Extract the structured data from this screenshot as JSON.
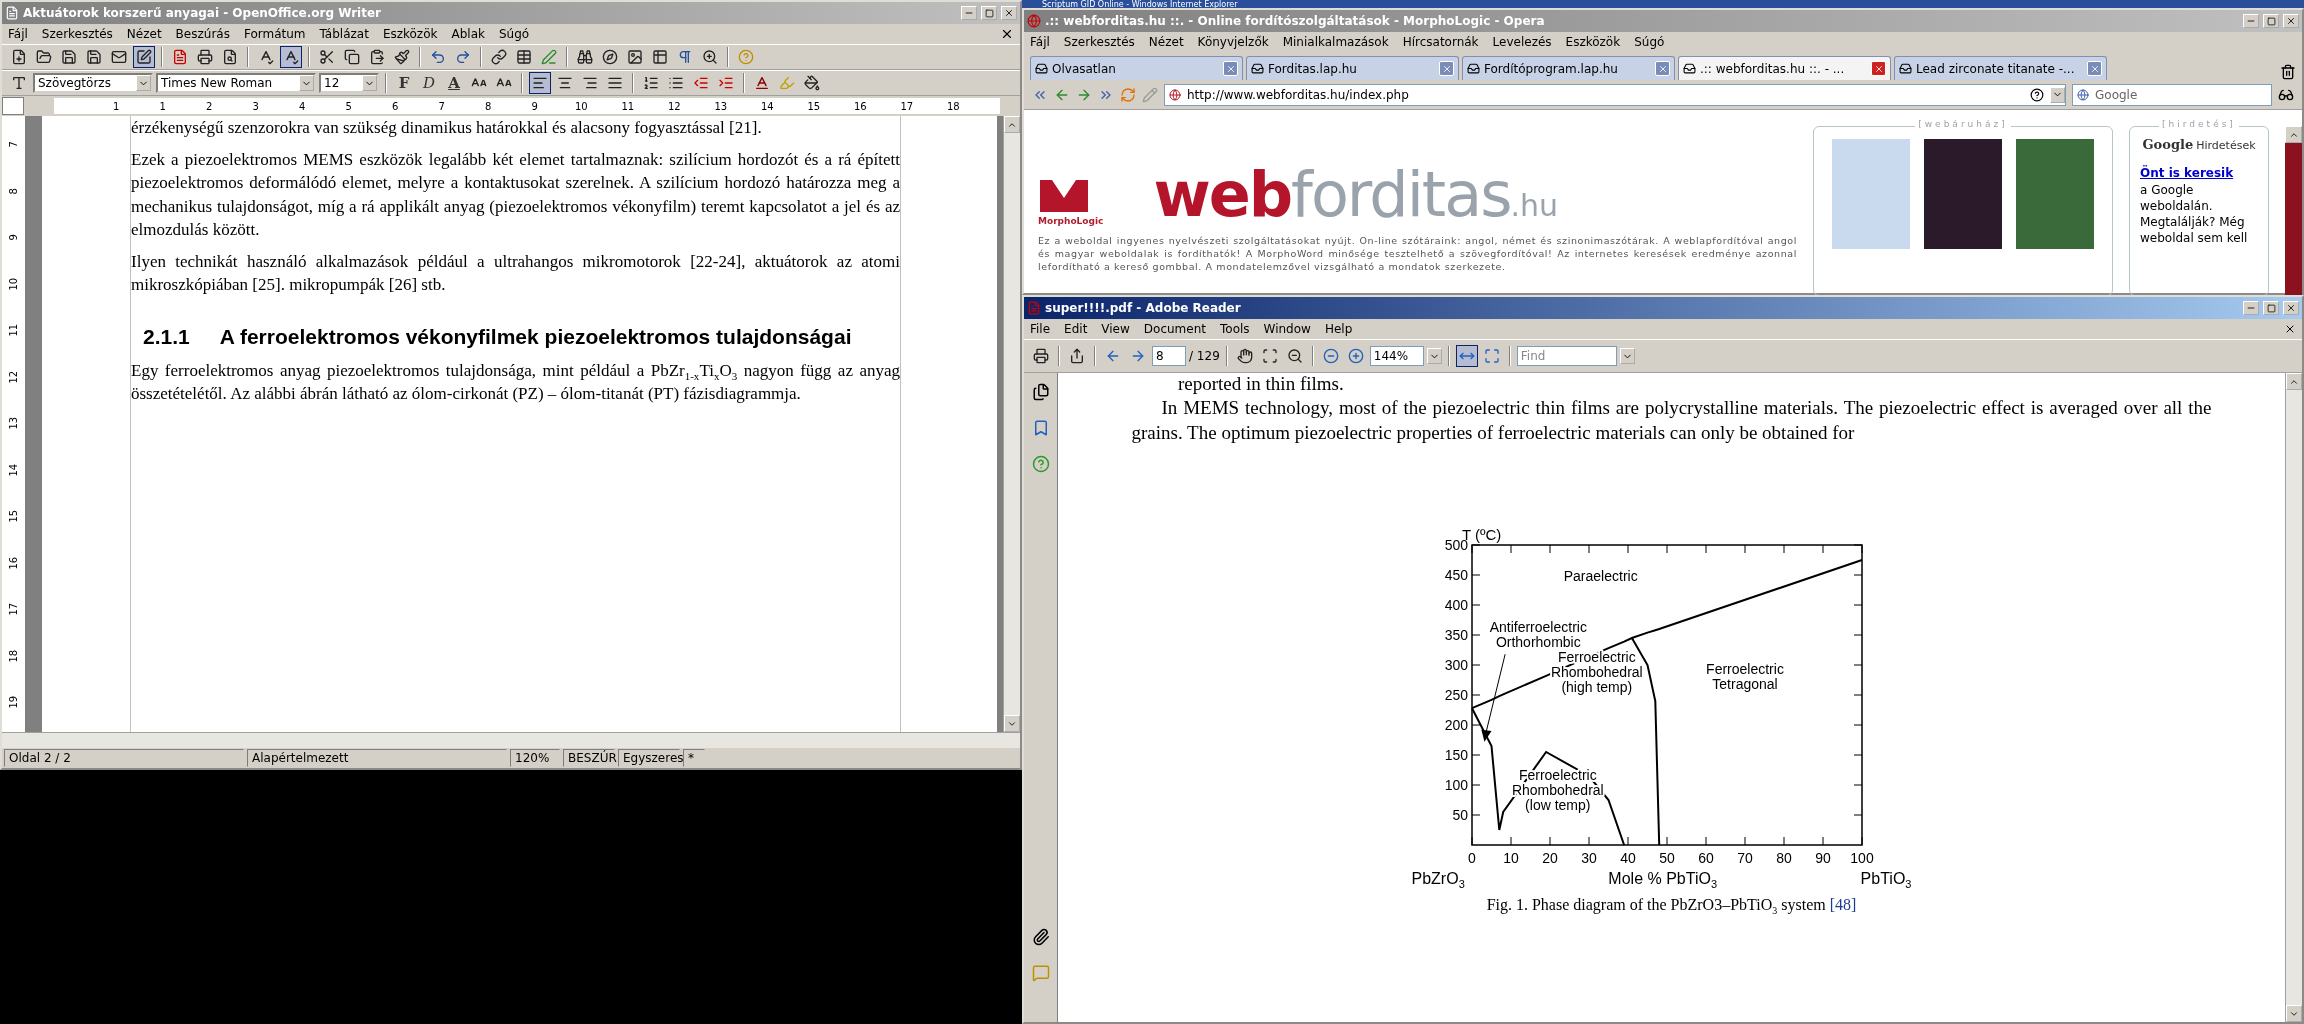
{
  "writer": {
    "title": "Aktuátorok korszerű anyagai - OpenOffice.org Writer",
    "menu": [
      "Fájl",
      "Szerkesztés",
      "Nézet",
      "Beszúrás",
      "Formátum",
      "Táblázat",
      "Eszközök",
      "Ablak",
      "Súgó"
    ],
    "toggles": [
      {
        "kind": "edit-mode",
        "on": true
      },
      {
        "kind": "auto-spellcheck",
        "on": true
      }
    ],
    "paragraph_style": "Szövegtörzs",
    "font_name": "Times New Roman",
    "font_size": "12",
    "format_buttons": [
      "F",
      "D",
      "A"
    ],
    "alignment": [
      {
        "kind": "left",
        "selected": true
      },
      {
        "kind": "center",
        "selected": false
      },
      {
        "kind": "right",
        "selected": false
      },
      {
        "kind": "justify",
        "selected": false
      }
    ],
    "ruler": {
      "horizontal": [
        "1",
        "1",
        "2",
        "3",
        "4",
        "5",
        "6",
        "7",
        "8",
        "9",
        "10",
        "11",
        "12",
        "13",
        "14",
        "15",
        "16",
        "17",
        "18"
      ],
      "vertical": [
        "7",
        "8",
        "9",
        "10",
        "11",
        "12",
        "13",
        "14",
        "15",
        "16",
        "17",
        "18",
        "19"
      ]
    },
    "document": [
      {
        "kind": "paragraph",
        "text": "érzékenységű szenzorokra van szükség dinamikus határokkal és alacsony fogyasztással [21]."
      },
      {
        "kind": "paragraph",
        "text": "Ezek a piezoelektromos MEMS eszközök legalább két elemet tartalmaznak: szilícium hordozót és a rá épített piezoelektromos deformálódó elemet, melyre a kontaktusokat szerelnek. A szilícium hordozó határozza meg a mechanikus tulajdonságot, míg a rá applikált anyag (piezoelektromos vékonyfilm) teremt kapcsolatot a jel és az elmozdulás között."
      },
      {
        "kind": "paragraph",
        "text": "Ilyen technikát használó alkalmazások például a ultrahangos mikromotorok [22-24], aktuátorok az atomi mikroszkópiában [25]. mikropumpák [26] stb."
      },
      {
        "kind": "heading",
        "number": "2.1.1",
        "text": "A ferroelektromos vékonyfilmek piezoelektromos tulajdonságai"
      },
      {
        "kind": "paragraph",
        "text": "Egy ferroelektromos anyag piezoelektromos tulajdonsága, mint például a PbZr$_{1-x}$Ti$_{x}$O$_{3}$ nagyon függ az anyag összetételétől. Az alábbi ábrán látható az ólom-cirkonát (PZ) – ólom-titanát (PT) fázisdiagrammja."
      }
    ],
    "status_bar": [
      "Oldal 2 / 2",
      "Alapértelmezett",
      "120%",
      "BESZÚR",
      "Egyszeres",
      "*"
    ]
  },
  "ie": {
    "title": "Scriptum GID Online - Windows Internet Explorer"
  },
  "opera": {
    "title": ".:: webforditas.hu ::. - Online fordítószolgáltatások - MorphoLogic - Opera",
    "menu": [
      "Fájl",
      "Szerkesztés",
      "Nézet",
      "Könyvjelzők",
      "Minialkalmazások",
      "Hírcsatornák",
      "Levelezés",
      "Eszközök",
      "Súgó"
    ],
    "tabs": [
      {
        "label": "Olvasatlan",
        "selected": false
      },
      {
        "label": "Forditas.lap.hu",
        "selected": false
      },
      {
        "label": "Fordítóprogram.lap.hu",
        "selected": false
      },
      {
        "label": ".:: webforditas.hu ::. - ...",
        "selected": true
      },
      {
        "label": "Lead zirconate titanate -...",
        "selected": false
      }
    ],
    "address": "http://www.webforditas.hu/index.php",
    "search": "Google",
    "page": {
      "logo_caption": "MorphoLogic",
      "brand": [
        "web",
        "forditas",
        ".hu"
      ],
      "intro": "Ez a weboldal ingyenes nyelvészeti szolgáltatásokat nyújt. On-line szótáraink: angol, német és szinonimaszótárak. A weblapfordítóval angol és magyar weboldalak is fordíthatók! A MorphoWord minősége tesztelhető a szövegfordítóval! Az internetes keresések eredménye azonnal lefordítható a kereső gombbal. A mondatelemzővel vizsgálható a mondatok szerkezete.",
      "shop_title": "[webáruház]",
      "ads_title": "[hirdetés]",
      "ads_brand": "Google",
      "ads_label": "Hirdetések",
      "ad_link": "Önt is keresik",
      "ad_text": "a Google weboldalán. Megtalálják? Még weboldal sem kell"
    }
  },
  "reader": {
    "title": "super!!!!.pdf - Adobe Reader",
    "menu": [
      "File",
      "Edit",
      "View",
      "Document",
      "Tools",
      "Window",
      "Help"
    ],
    "page": "8",
    "page_count": "/ 129",
    "zoom": "144%",
    "find_placeholder": "Find",
    "view_modes": [
      {
        "kind": "fit-width",
        "selected": true
      },
      {
        "kind": "fit-page",
        "selected": false
      }
    ],
    "top_line": "reported in thin films.",
    "paragraph": "In MEMS technology, most of the piezoelectric thin films are polycrystalline materials. The piezoelectric effect is averaged over all the grains. The optimum piezoelectric properties of ferroelectric materials can only be obtained for",
    "figure": {
      "left_label": "PbZrO$_{3}$",
      "right_label": "PbTiO$_{3}$",
      "caption": "Fig. 1. Phase diagram of the PbZrO3–PbTiO$_{3}$ system",
      "caption_link": "[48]",
      "chart_data": {
        "type": "line",
        "xlabel": "Mole % PbTiO$_{3}$",
        "ylabel": "T (ºC)",
        "x": [
          0,
          5,
          7,
          8,
          19,
          30,
          35,
          39,
          41,
          45,
          47,
          48,
          100
        ],
        "series": [
          {
            "color": "#000000",
            "values": [
              228,
              242,
              248,
              251,
              282,
              314,
              328,
              339,
              345,
              354,
              358,
              360,
              475
            ]
          },
          {
            "color": "#000000",
            "values": [
              null,
              null,
              null,
              null,
              null,
              null,
              null,
              null,
              345,
              300,
              240,
              0,
              null
            ]
          },
          {
            "color": "#000000",
            "values": [
              228,
              165,
              25,
              55,
              155,
              115,
              75,
              0,
              null,
              null,
              null,
              null,
              null
            ]
          }
        ],
        "xlim": [
          0,
          100
        ],
        "ylim": [
          0,
          500
        ],
        "xticks": [
          0,
          10,
          20,
          30,
          40,
          50,
          60,
          70,
          80,
          90,
          100
        ],
        "yticks": [
          50,
          100,
          150,
          200,
          250,
          300,
          350,
          400,
          450,
          500
        ],
        "annotations": [
          {
            "text": "Paraelectric"
          },
          {
            "text": "Antiferroelectric\nOrthorhombic"
          },
          {
            "text": "Ferroelectric\nRhombohedral\n(high temp)"
          },
          {
            "text": "Ferroelectric\nTetragonal"
          },
          {
            "text": "Ferroelectric\nRhombohedral\n(low temp)"
          }
        ]
      }
    }
  }
}
